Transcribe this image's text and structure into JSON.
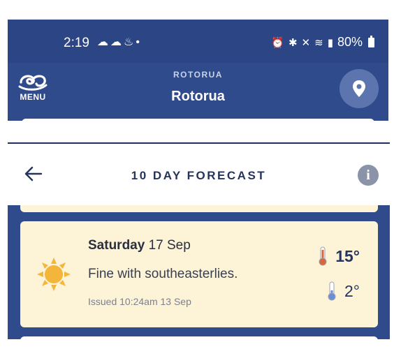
{
  "status_bar": {
    "time": "2:19",
    "left_icons": [
      "cloud-sun-icon",
      "cloud-icon",
      "drop-icon",
      "dot-icon"
    ],
    "right_icons": [
      "alarm-icon",
      "bluetooth-icon",
      "mute-icon",
      "wifi-icon",
      "signal-icon"
    ],
    "battery": "80%"
  },
  "app_header": {
    "menu_label": "MENU",
    "location_small": "ROTORUA",
    "location_title": "Rotorua"
  },
  "forecast": {
    "title": "10 DAY FORECAST",
    "day": {
      "day_name": "Saturday",
      "date": "17 Sep",
      "description": "Fine with southeasterlies.",
      "issued": "Issued 10:24am 13 Sep",
      "high": "15°",
      "low": "2°",
      "icon": "sun-icon"
    }
  },
  "colors": {
    "header_blue": "#2f4b8c",
    "card_cream": "#fdf3d7",
    "sun_yellow": "#f4b63a",
    "thermo_red": "#d9663a",
    "thermo_blue": "#6b8fd6"
  }
}
